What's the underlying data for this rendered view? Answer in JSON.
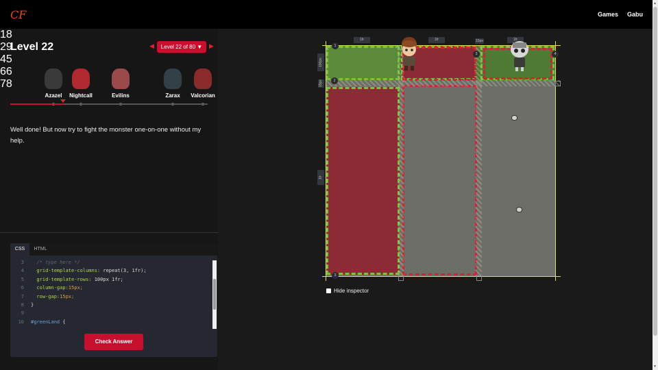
{
  "app": {
    "logo_text": "CF"
  },
  "nav": {
    "games": "Games",
    "user": "Gabu"
  },
  "level": {
    "title": "Level 22",
    "selector_label": "Level 22 of 80 ▼",
    "prev_icon": "triangle-left-icon",
    "next_icon": "triangle-right-icon"
  },
  "bosses": [
    {
      "name": "Azazel",
      "level": "18",
      "color": "#3a3a3a"
    },
    {
      "name": "Nightcall",
      "level": "29",
      "color": "#b02830"
    },
    {
      "name": "Evilins",
      "level": "45",
      "color": "#9a4a4a"
    },
    {
      "name": "Zarax",
      "level": "66",
      "color": "#344048"
    },
    {
      "name": "Valcorian",
      "level": "78",
      "color": "#8a2a2a"
    }
  ],
  "progress_fraction": 0.27,
  "instructions": "Well done! But now try to fight the monster one-on-one without my help.",
  "editor": {
    "tabs": [
      "CSS",
      "HTML"
    ],
    "active_tab": "CSS",
    "lines": [
      {
        "n": "3",
        "parts": [
          {
            "t": "  /* type here */",
            "c": "c-comment"
          }
        ]
      },
      {
        "n": "4",
        "parts": [
          {
            "t": "  grid-template-columns: ",
            "c": "c-prop"
          },
          {
            "t": "repeat(3, 1fr);",
            "c": "c-plain"
          }
        ]
      },
      {
        "n": "5",
        "parts": [
          {
            "t": "  grid-template-rows: ",
            "c": "c-prop"
          },
          {
            "t": "100px 1fr;",
            "c": "c-plain"
          }
        ]
      },
      {
        "n": "6",
        "parts": [
          {
            "t": "  column-gap:",
            "c": "c-prop"
          },
          {
            "t": "15px;",
            "c": "c-val"
          }
        ]
      },
      {
        "n": "7",
        "parts": [
          {
            "t": "  row-gap:",
            "c": "c-prop"
          },
          {
            "t": "15px;",
            "c": "c-val"
          }
        ]
      },
      {
        "n": "8",
        "parts": [
          {
            "t": "}",
            "c": "c-plain"
          }
        ]
      },
      {
        "n": "9",
        "parts": [
          {
            "t": "",
            "c": "c-plain"
          }
        ]
      },
      {
        "n": "10",
        "parts": [
          {
            "t": "#greenLand",
            "c": "c-sel"
          },
          {
            "t": " {",
            "c": "c-plain"
          }
        ]
      }
    ],
    "check_button": "Check Answer"
  },
  "inspector": {
    "col_labels": [
      "1fr",
      "1fr",
      "15px",
      "1fr"
    ],
    "row_labels": [
      "100px",
      "15px",
      "1fr"
    ],
    "line_numbers": [
      "1",
      "2",
      "3",
      "4",
      "3"
    ],
    "hide_label": "Hide inspector"
  },
  "colors": {
    "accent": "#c8102e",
    "grass_green": "#4e7a34",
    "red_zone": "#8c2a36",
    "grid_line": "#d8e45a",
    "dash_green": "#7cc23c",
    "dash_red": "#c8283a"
  }
}
